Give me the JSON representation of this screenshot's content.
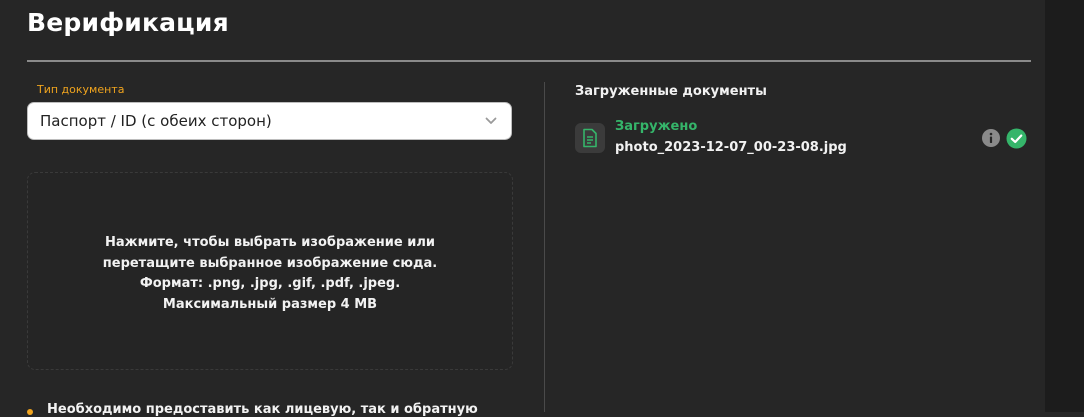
{
  "page": {
    "title": "Верификация"
  },
  "document_type": {
    "label": "Тип документа",
    "selected": "Паспорт / ID (с обеих сторон)"
  },
  "dropzone": {
    "lines": [
      "Нажмите, чтобы выбрать изображение или",
      "перетащите выбранное изображение сюда.",
      "Формат: .png, .jpg, .gif, .pdf, .jpeg.",
      "Максимальный размер 4 MB"
    ]
  },
  "note": "Необходимо предоставить как лицевую, так и обратную",
  "uploaded": {
    "title": "Загруженные документы",
    "files": [
      {
        "status": "Загружено",
        "name": "photo_2023-12-07_00-23-08.jpg"
      }
    ]
  },
  "colors": {
    "accent": "#f0a41e",
    "success": "#35b56a",
    "background": "#262626"
  },
  "icons": {
    "file": "file-document-icon",
    "info": "info-icon",
    "check": "check-circle-icon",
    "chevron": "chevron-down-icon"
  }
}
